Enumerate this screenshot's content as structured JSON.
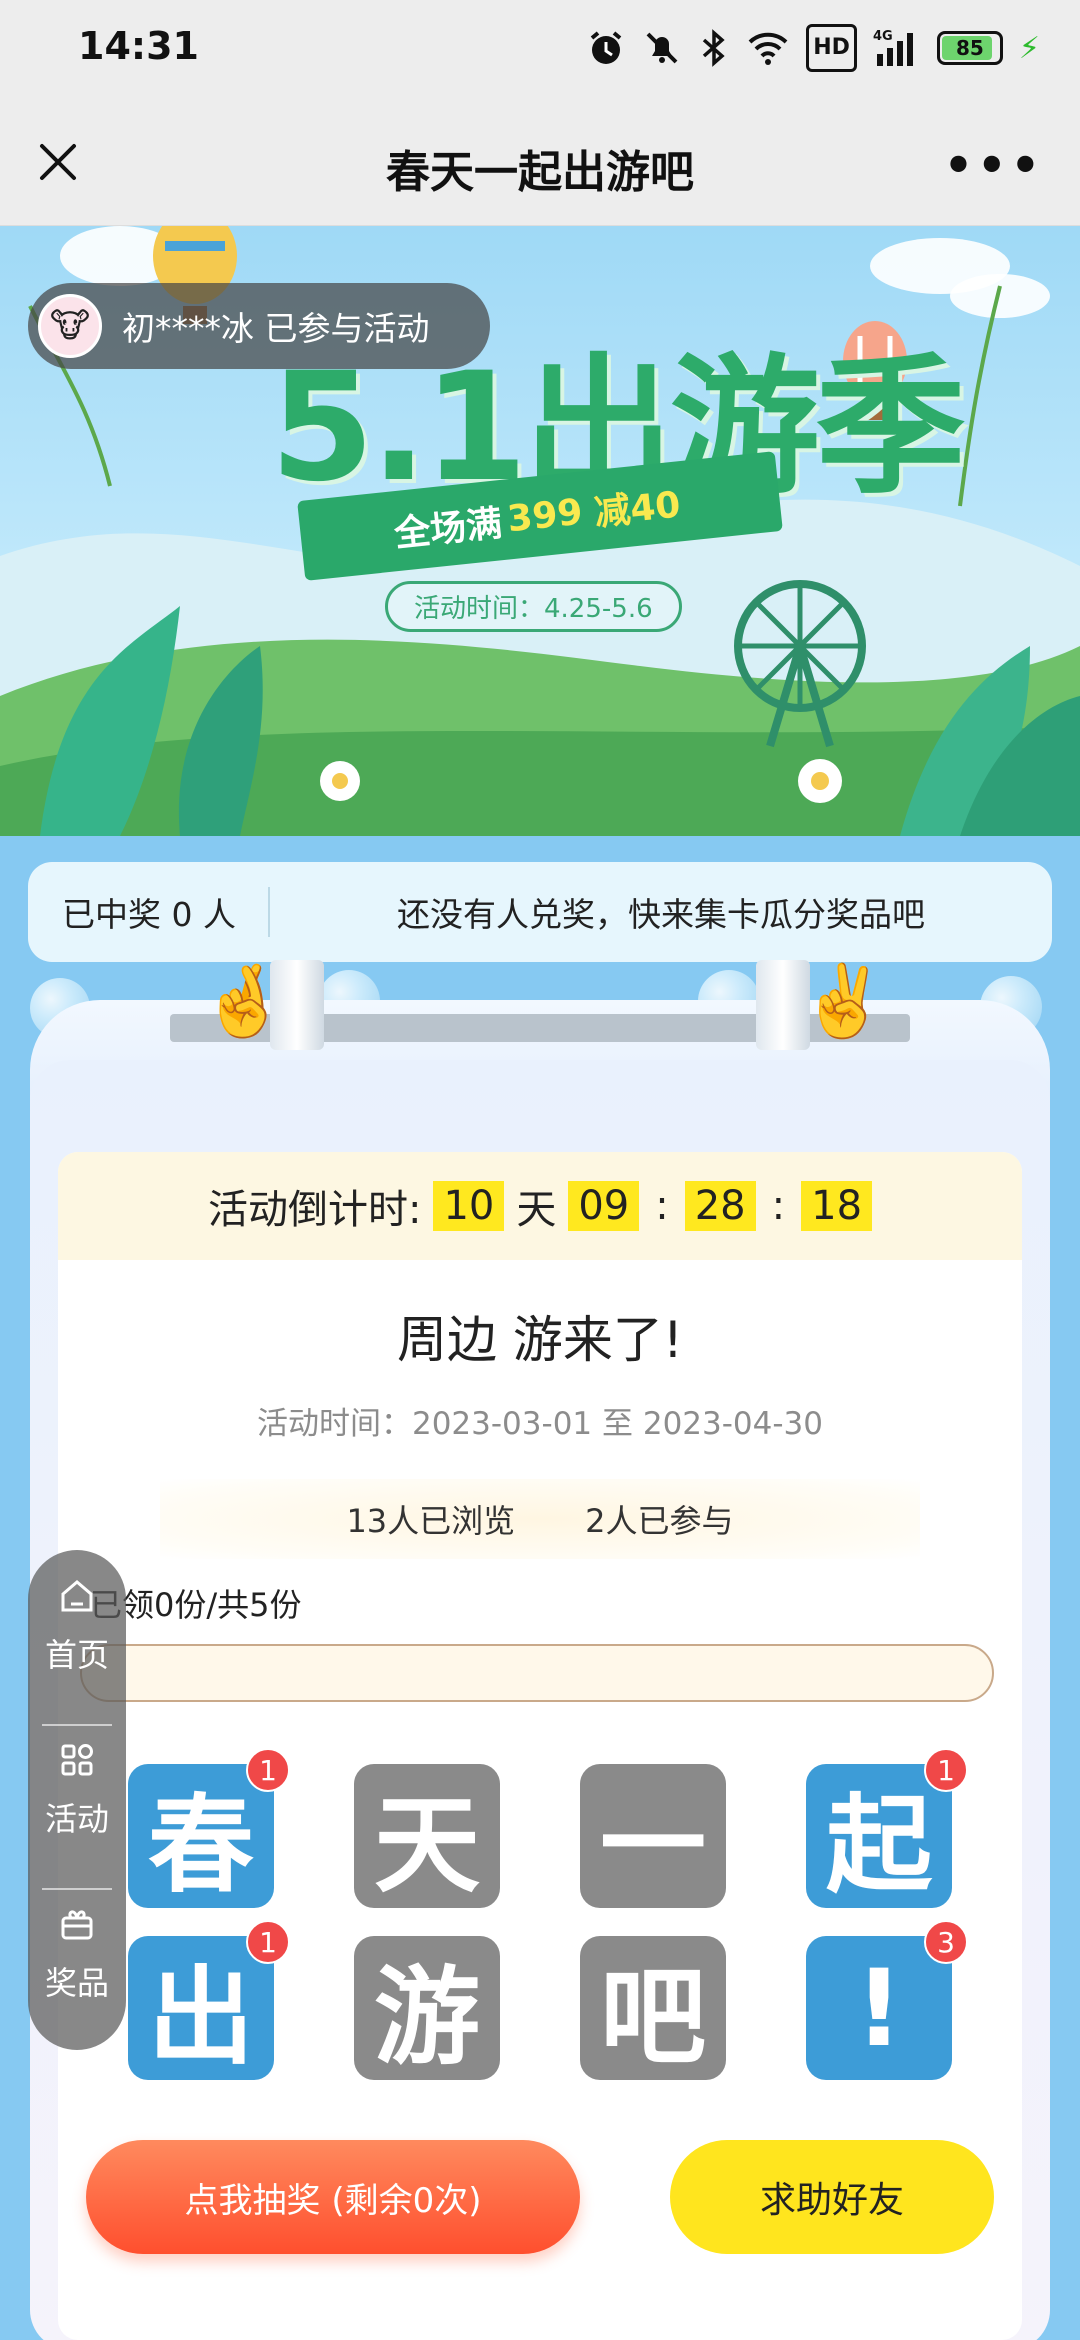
{
  "status_bar": {
    "time": "14:31",
    "hd_label": "HD",
    "network_label": "4G",
    "battery_level": "85",
    "icons": [
      "alarm-icon",
      "mute-icon",
      "bluetooth-icon",
      "wifi-icon",
      "hd-icon",
      "signal-icon",
      "battery-icon",
      "charging-icon"
    ]
  },
  "nav": {
    "title": "春天一起出游吧",
    "close_icon": "close-icon",
    "more_icon": "more-icon"
  },
  "banner": {
    "headline": "5.1出游季",
    "promo_prefix": "全场满",
    "promo_amount": "399",
    "promo_suffix": "减40",
    "period": "活动时间：4.25-5.6"
  },
  "participant": {
    "text": "初****冰 已参与活动"
  },
  "winners": {
    "count_text": "已中奖 0 人",
    "marquee": "还没有人兑奖，快来集卡瓜分奖品吧"
  },
  "countdown": {
    "label": "活动倒计时:",
    "days": "10",
    "days_unit": "天",
    "hours": "09",
    "minutes": "28",
    "seconds": "18",
    "separator": ":"
  },
  "activity": {
    "title": "周边 游来了!",
    "dates": "活动时间：2023-03-01 至 2023-04-30",
    "views": "13人已浏览",
    "participants": "2人已参与"
  },
  "progress": {
    "label": "已领0份/共5份",
    "claimed": 0,
    "total": 5
  },
  "cards": [
    {
      "char": "春",
      "owned": true,
      "count": "1"
    },
    {
      "char": "天",
      "owned": false,
      "count": ""
    },
    {
      "char": "一",
      "owned": false,
      "count": ""
    },
    {
      "char": "起",
      "owned": true,
      "count": "1"
    },
    {
      "char": "出",
      "owned": true,
      "count": "1"
    },
    {
      "char": "游",
      "owned": false,
      "count": ""
    },
    {
      "char": "吧",
      "owned": false,
      "count": ""
    },
    {
      "char": "!",
      "owned": true,
      "count": "3"
    }
  ],
  "actions": {
    "draw_label": "点我抽奖 (剩余0次)",
    "help_label": "求助好友"
  },
  "float_nav": {
    "home_label": "首页",
    "activity_label": "活动",
    "prize_label": "奖品"
  },
  "colors": {
    "background": "#86c9f2",
    "owned_card": "#3d9cd7",
    "missing_card": "#8a8a8a",
    "badge": "#f04848",
    "countdown_highlight": "#ffe81f",
    "draw_button": "#ff5a35",
    "help_button": "#ffe51e"
  }
}
